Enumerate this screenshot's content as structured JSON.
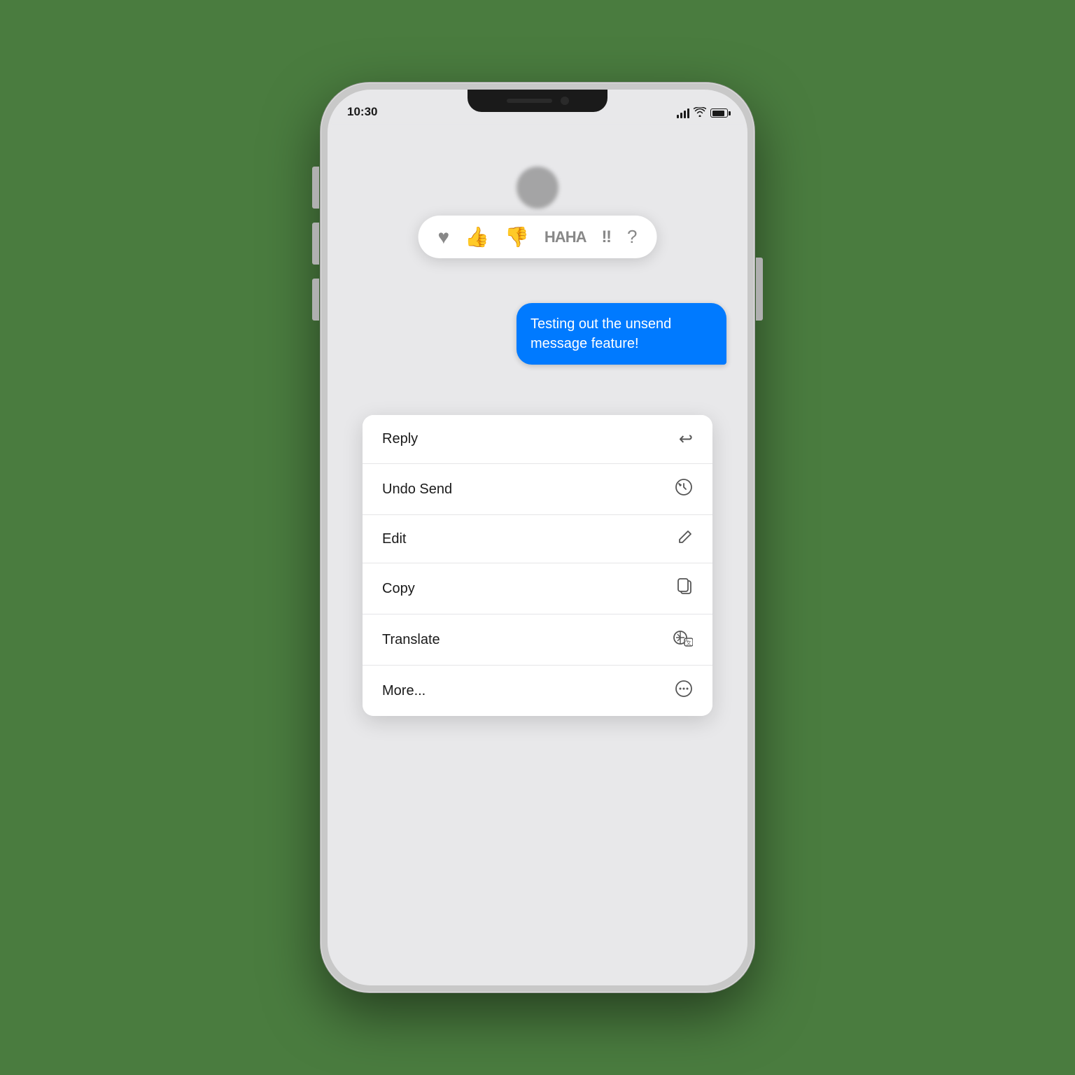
{
  "background_color": "#4a7c3f",
  "status_bar": {
    "time": "10:30",
    "battery_level": 85
  },
  "reaction_bar": {
    "emojis": [
      "❤️",
      "👍",
      "👎",
      "HAHA",
      "!!",
      "?"
    ]
  },
  "message_bubble": {
    "text": "Testing out the unsend message feature!",
    "background": "#007AFF",
    "text_color": "#ffffff"
  },
  "context_menu": {
    "items": [
      {
        "label": "Reply",
        "icon": "↩",
        "icon_name": "reply-icon"
      },
      {
        "label": "Undo Send",
        "icon": "↺",
        "icon_name": "undo-send-icon"
      },
      {
        "label": "Edit",
        "icon": "✏",
        "icon_name": "edit-icon"
      },
      {
        "label": "Copy",
        "icon": "⧉",
        "icon_name": "copy-icon"
      },
      {
        "label": "Translate",
        "icon": "🌐",
        "icon_name": "translate-icon"
      },
      {
        "label": "More...",
        "icon": "⊙",
        "icon_name": "more-icon"
      }
    ]
  }
}
